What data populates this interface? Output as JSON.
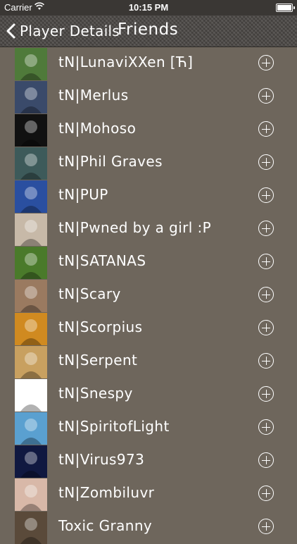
{
  "status_bar": {
    "carrier": "Carrier",
    "time": "10:15 PM",
    "battery_level": 1.0
  },
  "nav": {
    "back_label": "Player Details",
    "title": "Friends",
    "back_icon": "chevron-left-icon"
  },
  "colors": {
    "background": "#6e665c",
    "navbar": "#4a4744",
    "text": "#ffffff"
  },
  "friends": [
    {
      "name": "tN|LunaviXXen [Ћ]",
      "avatar_icon": "knight-helmet-avatar",
      "avatar_color": "#4f7a3a"
    },
    {
      "name": "tN|Merlus",
      "avatar_icon": "hooded-figure-avatar",
      "avatar_color": "#3a4a6a"
    },
    {
      "name": "tN|Mohoso",
      "avatar_icon": "skull-avatar",
      "avatar_color": "#111111"
    },
    {
      "name": "tN|Phil Graves",
      "avatar_icon": "figure-scene-avatar",
      "avatar_color": "#3d5a5a"
    },
    {
      "name": "tN|PUP",
      "avatar_icon": "blue-monster-avatar",
      "avatar_color": "#2a4fa0"
    },
    {
      "name": "tN|Pwned by a girl :P",
      "avatar_icon": "pug-avatar",
      "avatar_color": "#c7b9a8"
    },
    {
      "name": "tN|SATANAS",
      "avatar_icon": "person-green-avatar",
      "avatar_color": "#4a7a2a"
    },
    {
      "name": "tN|Scary",
      "avatar_icon": "sunglasses-man-avatar",
      "avatar_color": "#9a7a60"
    },
    {
      "name": "tN|Scorpius",
      "avatar_icon": "ninja-mask-avatar",
      "avatar_color": "#d08a20"
    },
    {
      "name": "tN|Serpent",
      "avatar_icon": "golden-face-avatar",
      "avatar_color": "#c8a060"
    },
    {
      "name": "tN|Snespy",
      "avatar_icon": "pixel-robot-avatar",
      "avatar_color": "#ffffff"
    },
    {
      "name": "tN|SpiritofLight",
      "avatar_icon": "blue-car-avatar",
      "avatar_color": "#5aa0d0"
    },
    {
      "name": "tN|Virus973",
      "avatar_icon": "blue-light-avatar",
      "avatar_color": "#101840"
    },
    {
      "name": "tN|Zombiluvr",
      "avatar_icon": "woman-portrait-avatar",
      "avatar_color": "#d8b8a8"
    },
    {
      "name": "Toxic Granny",
      "avatar_icon": "dark-portrait-avatar",
      "avatar_color": "#5a4a3a"
    }
  ]
}
